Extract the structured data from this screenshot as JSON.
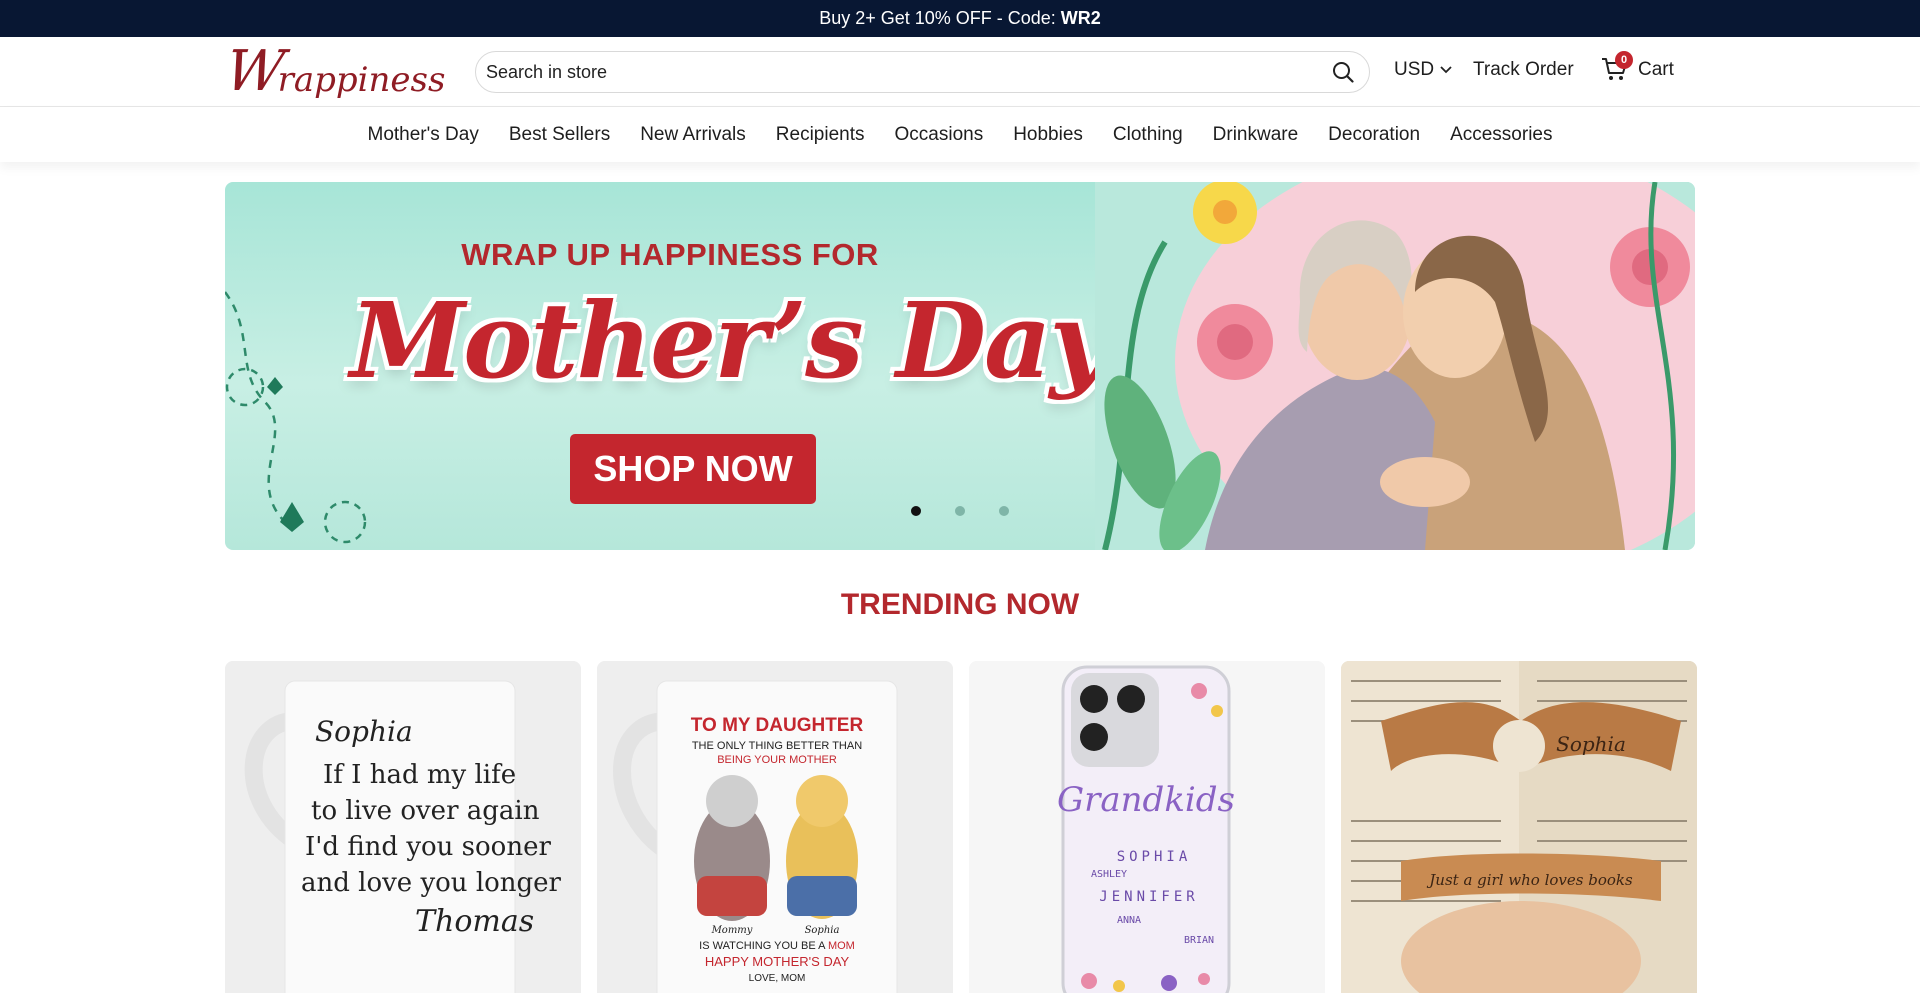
{
  "announcement": {
    "text": "Buy 2+ Get 10% OFF - Code:",
    "code": "WR2"
  },
  "header": {
    "logo_initial": "W",
    "logo_rest": "rappiness",
    "search_placeholder": "Search in store",
    "currency": "USD",
    "track_order": "Track Order",
    "cart_label": "Cart",
    "cart_count": "0"
  },
  "nav": {
    "items": [
      "Mother's Day",
      "Best Sellers",
      "New Arrivals",
      "Recipients",
      "Occasions",
      "Hobbies",
      "Clothing",
      "Drinkware",
      "Decoration",
      "Accessories"
    ]
  },
  "banner": {
    "line1": "WRAP UP HAPPINESS FOR",
    "line2": "Mother’s Day",
    "cta": "SHOP NOW",
    "active_slide": 1,
    "slide_count": 3
  },
  "trending": {
    "title": "TRENDING NOW"
  },
  "products": [
    {
      "kind": "mug",
      "mug_text": [
        "Sophia",
        "If I had my life",
        "to live over again",
        "I'd find you sooner",
        "and love you longer",
        "Thomas"
      ]
    },
    {
      "kind": "mug",
      "mug_text": [
        "TO MY DAUGHTER",
        "THE ONLY THING BETTER THAN",
        "BEING YOUR MOTHER",
        "Mommy",
        "Sophia",
        "IS WATCHING YOU BE A",
        "MOM",
        "HAPPY MOTHER'S DAY",
        "LOVE, MOM"
      ]
    },
    {
      "kind": "phone-case",
      "case_text": [
        "Grandkids",
        "SOPHIA",
        "ASHLEY",
        "JENNIFER",
        "ANNA",
        "BRIAN"
      ]
    },
    {
      "kind": "page-holder",
      "holder_text": [
        "Sophia",
        "Just a girl who loves books"
      ]
    }
  ],
  "colors": {
    "announcement_bg": "#081733",
    "brand_red": "#c4262e",
    "title_red": "#b3282d",
    "banner_bg": "#a7e5d7"
  }
}
